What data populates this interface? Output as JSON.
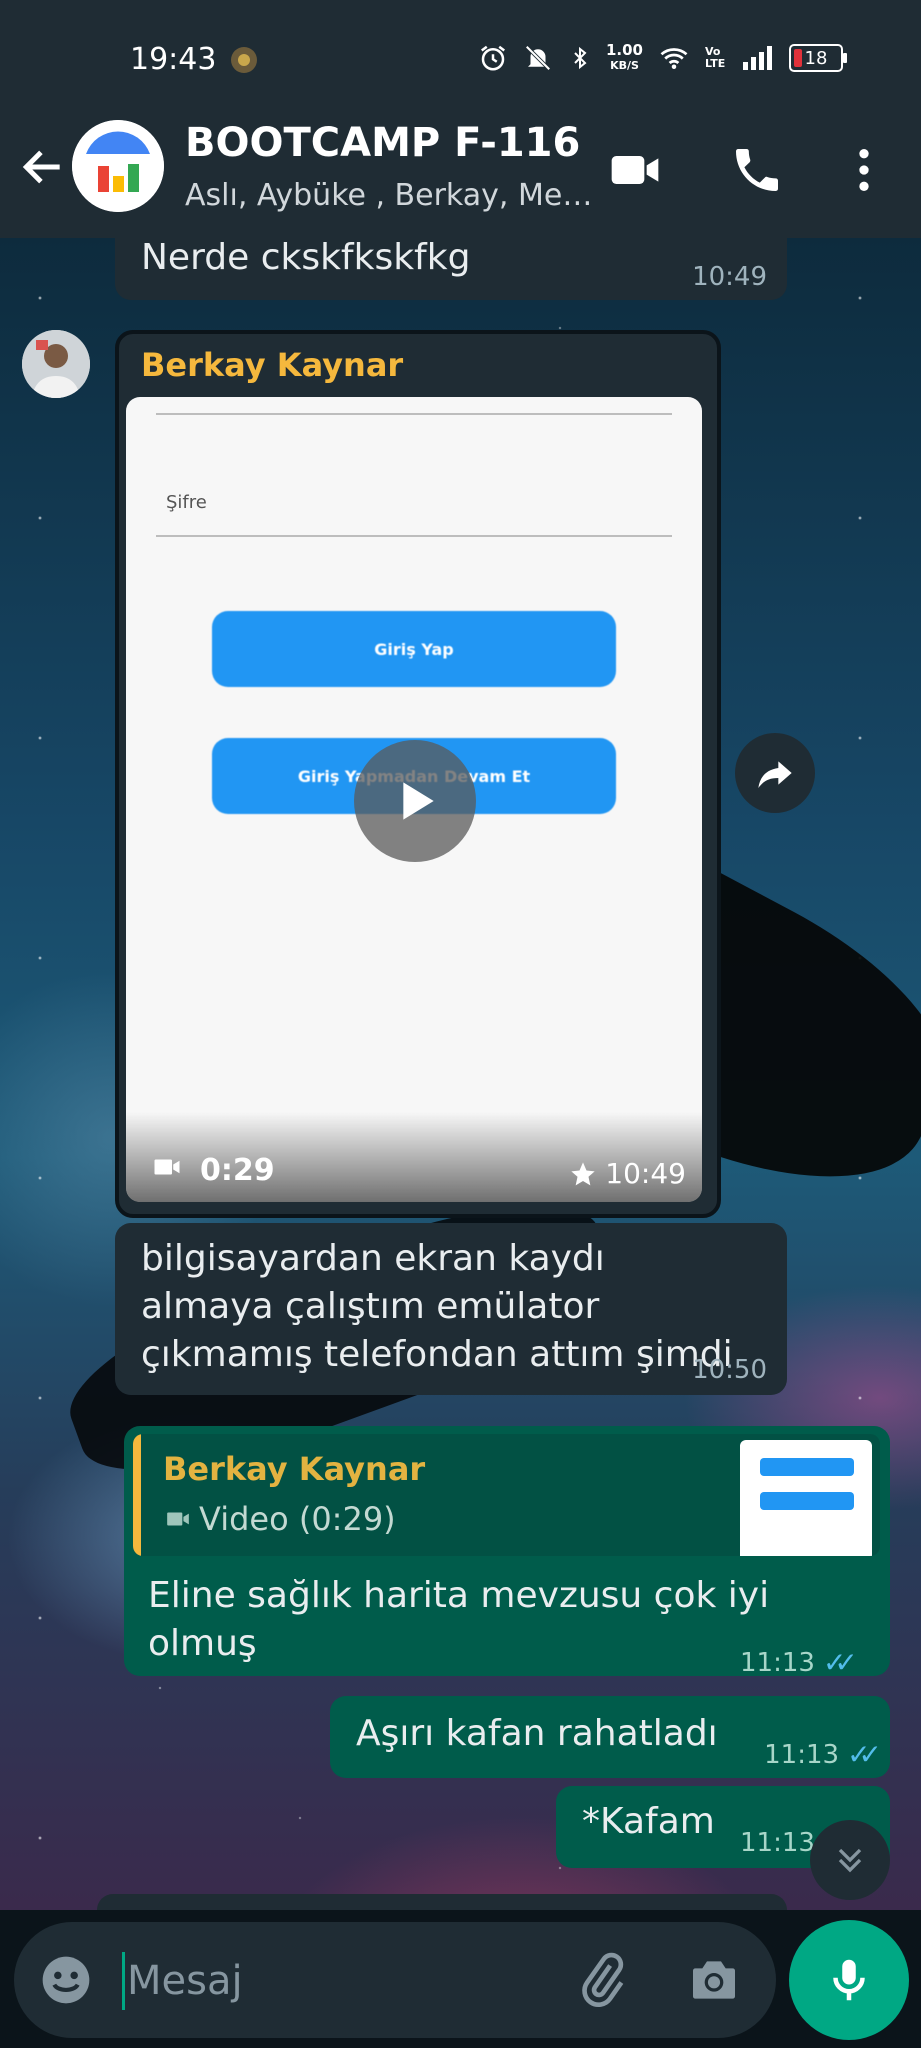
{
  "status_bar": {
    "time": "19:43",
    "net_speed_value": "1.00",
    "net_speed_unit": "KB/S",
    "volte": "Vo LTE",
    "battery": "18"
  },
  "header": {
    "title": "BOOTCAMP F-116",
    "subtitle": "Aslı, Aybüke , Berkay, Me…"
  },
  "messages": {
    "m1": {
      "text": "Nerde ckskfkskfkg",
      "time": "10:49"
    },
    "m2": {
      "sender": "Berkay Kaynar",
      "video": {
        "field_label": "Şifre",
        "button1": "Giriş Yap",
        "button2": "Giriş Yapmadan Devam Et",
        "duration": "0:29",
        "time": "10:49"
      }
    },
    "m3": {
      "text": "bilgisayardan ekran kaydı almaya çalıştım emülator çıkmamış telefondan attım şimdi",
      "time": "10:50"
    },
    "m4": {
      "quote_sender": "Berkay Kaynar",
      "quote_text": "Video (0:29)",
      "text": "Eline sağlık harita mevzusu çok iyi olmuş",
      "time": "11:13"
    },
    "m5": {
      "text": "Aşırı kafan rahatladı",
      "time": "11:13"
    },
    "m6": {
      "text": "*Kafam",
      "time": "11:13"
    }
  },
  "composer": {
    "placeholder": "Mesaj"
  },
  "colors": {
    "header_bg": "#1f2c34",
    "incoming_bubble": "#1f2c34",
    "outgoing_bubble": "#005c4b",
    "accent": "#00a884",
    "sender_name": "#f5b83d",
    "read_ticks": "#53bdeb"
  },
  "icons": [
    "back-arrow-icon",
    "group-avatar",
    "video-call-icon",
    "phone-icon",
    "more-vert-icon",
    "play-icon",
    "video-camera-icon",
    "star-icon",
    "forward-icon",
    "double-check-icon",
    "chevron-double-down-icon",
    "emoji-icon",
    "attach-icon",
    "camera-icon",
    "mic-icon"
  ]
}
